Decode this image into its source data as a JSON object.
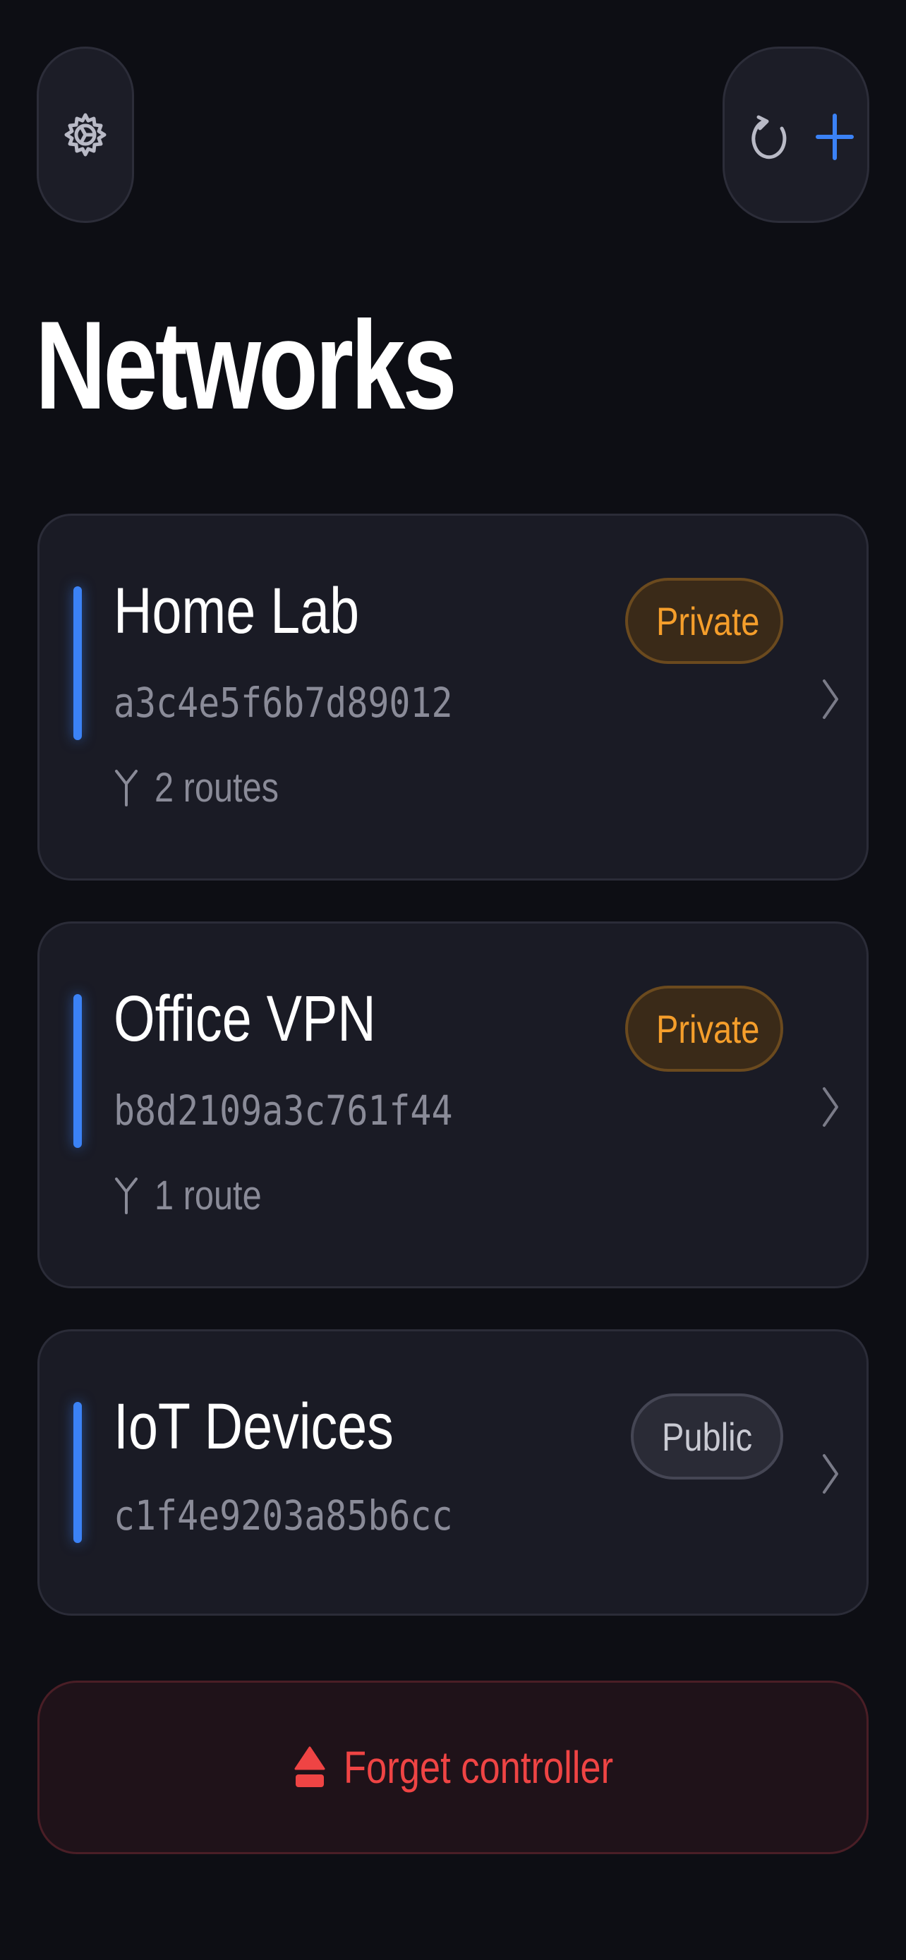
{
  "header": {
    "title": "Networks",
    "icons": {
      "settings": "gear-icon",
      "refresh": "refresh-icon",
      "add": "plus-icon"
    }
  },
  "networks": [
    {
      "name": "Home Lab",
      "id": "a3c4e5f6b7d89012",
      "routes": "2 routes",
      "visibility": "Private",
      "visibility_icon": "lock-icon"
    },
    {
      "name": "Office VPN",
      "id": "b8d2109a3c761f44",
      "routes": "1 route",
      "visibility": "Private",
      "visibility_icon": "lock-icon"
    },
    {
      "name": "IoT Devices",
      "id": "c1f4e9203a85b6cc",
      "visibility": "Public",
      "visibility_icon": "globe-icon"
    }
  ],
  "footer": {
    "forget_label": "Forget controller",
    "forget_icon": "eject-icon"
  },
  "colors": {
    "background": "#0d0e14",
    "card": "#1a1b25",
    "accent": "#3b82f6",
    "private": "#f59e2b",
    "danger": "#ef4444",
    "muted": "#8a8b98"
  }
}
